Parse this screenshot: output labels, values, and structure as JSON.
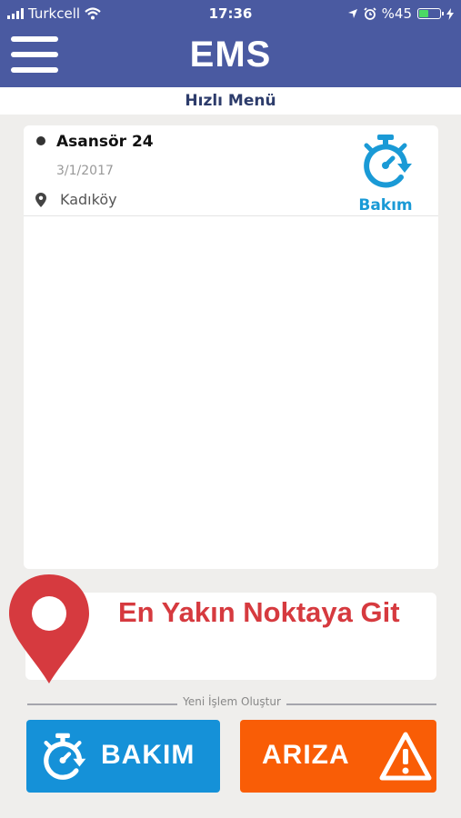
{
  "status_bar": {
    "carrier": "Turkcell",
    "time": "17:36",
    "battery": "%45",
    "battery_level": 0.45
  },
  "header": {
    "title": "EMS",
    "menu_icon": "hamburger-icon"
  },
  "quick_menu": {
    "title": "Hızlı Menü"
  },
  "records": [
    {
      "title": "Asansör 24",
      "date": "3/1/2017",
      "location": "Kadıköy",
      "type_label": "Bakım",
      "type_icon": "stopwatch-icon"
    }
  ],
  "nearest": {
    "label": "En Yakın Noktaya Git",
    "icon": "location-pin-icon"
  },
  "new_operation": {
    "section_label": "Yeni İşlem Oluştur",
    "bakim_label": "BAKIM",
    "ariza_label": "ARIZA",
    "bakim_icon": "stopwatch-icon",
    "ariza_icon": "warning-icon"
  },
  "colors": {
    "header": "#4a5aa1",
    "bakim": "#1591d8",
    "ariza": "#f95d06",
    "pin": "#d63a3f"
  }
}
